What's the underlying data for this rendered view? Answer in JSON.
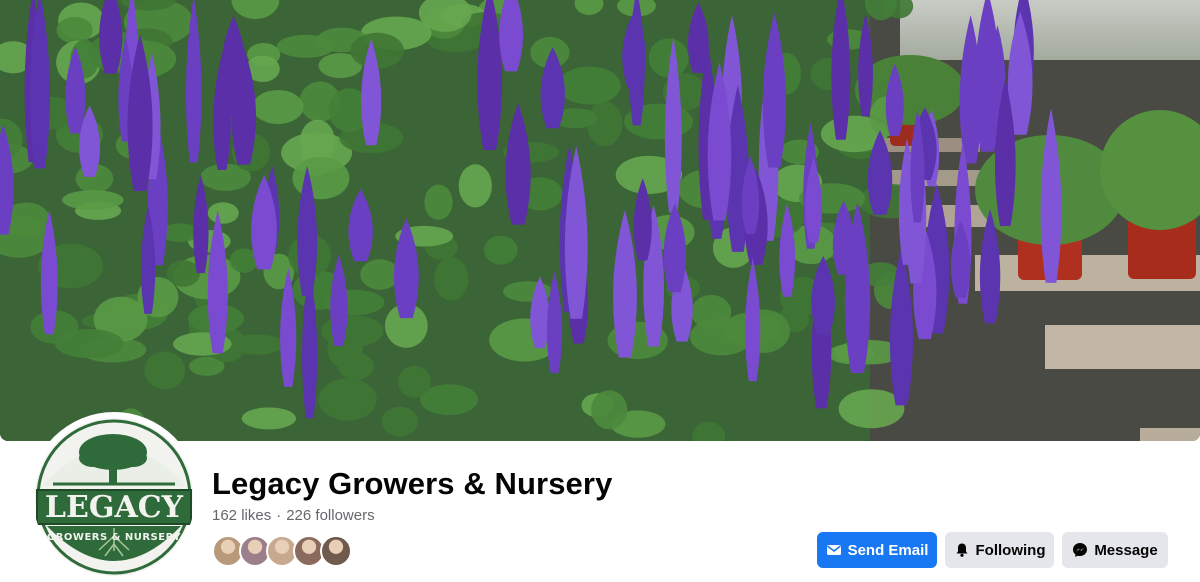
{
  "page": {
    "name": "Legacy Growers & Nursery",
    "likes": "162 likes",
    "separator": "·",
    "followers": "226 followers"
  },
  "profile_logo": {
    "main_text": "LEGACY",
    "sub_text": "GROWERS & NURSERY",
    "brand_color": "#2f6b3a"
  },
  "friends": [
    {
      "name": "friend-avatar",
      "color": "#b89a7a"
    },
    {
      "name": "friend-avatar",
      "color": "#9c7f8a"
    },
    {
      "name": "friend-avatar",
      "color": "#c7a98f"
    },
    {
      "name": "friend-avatar",
      "color": "#8a6a5c"
    },
    {
      "name": "friend-avatar",
      "color": "#6f5a4d"
    }
  ],
  "actions": {
    "send_email": "Send Email",
    "following": "Following",
    "message": "Message",
    "icons": [
      "mail-icon",
      "bell-icon",
      "messenger-icon"
    ]
  },
  "colors": {
    "primary_button": "#1877f2",
    "secondary_button": "#e4e6eb",
    "secondary_text": "#65676b",
    "flower_purple": "#6a3fc2"
  }
}
